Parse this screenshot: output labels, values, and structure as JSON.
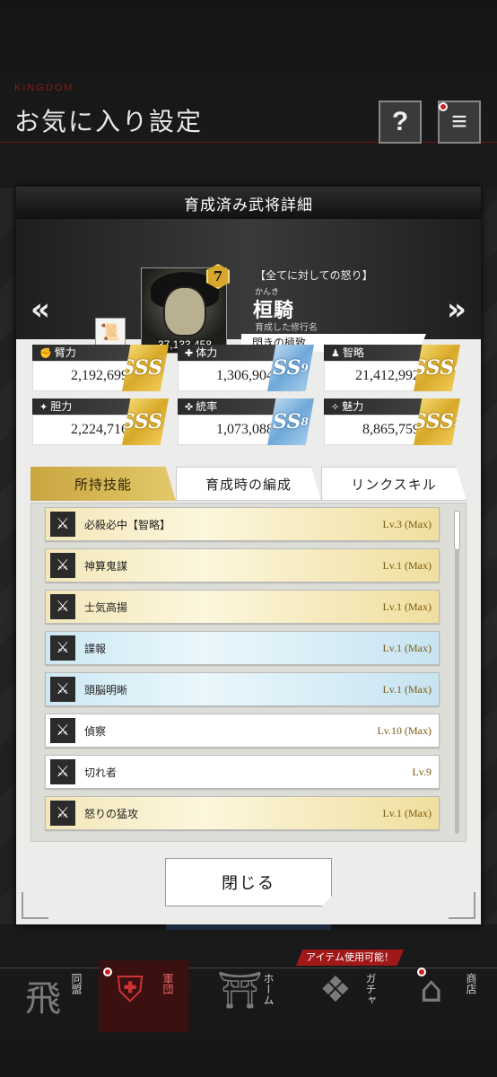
{
  "header": {
    "brand": "KINGDOM",
    "title": "お気に入り設定",
    "help_label": "?",
    "menu_label": "≡"
  },
  "modal": {
    "title": "育成済み武将詳細",
    "general": {
      "title_tag": "【全てに対しての怒り】",
      "furigana": "かんき",
      "name": "桓騎",
      "rank": "7",
      "power": "37,133,458",
      "train_label": "育成した修行名",
      "train_value": "閃きの極致"
    },
    "stats": [
      {
        "icon": "✊",
        "label": "臂力",
        "value": "2,192,699",
        "grade": "SSS",
        "grade_num": "1",
        "tier": "gold"
      },
      {
        "icon": "✚",
        "label": "体力",
        "value": "1,306,904",
        "grade": "SS",
        "grade_num": "9",
        "tier": "blue"
      },
      {
        "icon": "♟",
        "label": "智略",
        "value": "21,412,992",
        "grade": "SSS",
        "grade_num": "6",
        "tier": "gold"
      },
      {
        "icon": "✦",
        "label": "胆力",
        "value": "2,224,716",
        "grade": "SSS",
        "grade_num": "1",
        "tier": "gold"
      },
      {
        "icon": "✜",
        "label": "統率",
        "value": "1,073,088",
        "grade": "SS",
        "grade_num": "8",
        "tier": "blue"
      },
      {
        "icon": "✧",
        "label": "魅力",
        "value": "8,865,759",
        "grade": "SSS",
        "grade_num": "3",
        "tier": "gold"
      }
    ],
    "tabs": [
      "所持技能",
      "育成時の編成",
      "リンクスキル"
    ],
    "skills": [
      {
        "name": "必殺必中【智略】",
        "level": "Lv.3 (Max)",
        "tier": "gold"
      },
      {
        "name": "神算鬼謀",
        "level": "Lv.1 (Max)",
        "tier": "gold"
      },
      {
        "name": "士気高揚",
        "level": "Lv.1 (Max)",
        "tier": "gold"
      },
      {
        "name": "諜報",
        "level": "Lv.1 (Max)",
        "tier": "blue"
      },
      {
        "name": "頭脳明晰",
        "level": "Lv.1 (Max)",
        "tier": "blue"
      },
      {
        "name": "偵察",
        "level": "Lv.10 (Max)",
        "tier": "white"
      },
      {
        "name": "切れ者",
        "level": "Lv.9",
        "tier": "white"
      },
      {
        "name": "怒りの猛攻",
        "level": "Lv.1 (Max)",
        "tier": "gold"
      }
    ],
    "close_label": "閉じる"
  },
  "nav": {
    "ribbon": "アイテム使用可能！",
    "items": [
      {
        "label": "同盟",
        "icon": "飛"
      },
      {
        "label": "軍団",
        "icon": "⛨"
      },
      {
        "label": "ホーム",
        "icon": "⛩"
      },
      {
        "label": "ガチャ",
        "icon": "❖"
      },
      {
        "label": "商店",
        "icon": "⌂"
      }
    ]
  }
}
